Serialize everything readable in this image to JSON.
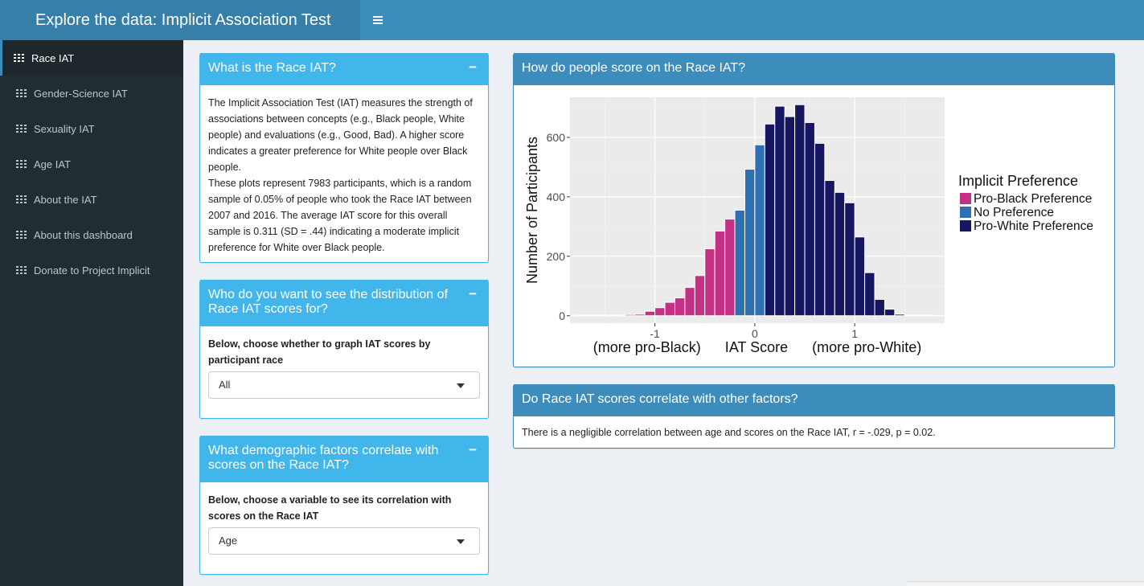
{
  "header": {
    "title": "Explore the data: Implicit Association Test",
    "menu_icon": "hamburger-icon"
  },
  "sidebar": {
    "items": [
      {
        "label": "Race IAT",
        "icon": "grid-icon",
        "active": true
      },
      {
        "label": "Gender-Science IAT",
        "icon": "grid-icon",
        "active": false
      },
      {
        "label": "Sexuality IAT",
        "icon": "grid-icon",
        "active": false
      },
      {
        "label": "Age IAT",
        "icon": "grid-icon",
        "active": false
      },
      {
        "label": "About the IAT",
        "icon": "grid-icon",
        "active": false
      },
      {
        "label": "About this dashboard",
        "icon": "grid-icon",
        "active": false
      },
      {
        "label": "Donate to Project Implicit",
        "icon": "grid-icon",
        "active": false
      }
    ]
  },
  "what_box": {
    "title": "What is the Race IAT?",
    "collapse": "−",
    "para1": "The Implicit Association Test (IAT) measures the strength of associations between concepts (e.g., Black people, White people) and evaluations (e.g., Good, Bad). A higher score indicates a greater preference for White people over Black people.",
    "para2": "These plots represent 7983 participants, which is a random sample of 0.05% of people who took the Race IAT between 2007 and 2016. The average IAT score for this overall sample is 0.311 (SD = .44) indicating a moderate implicit preference for White over Black people."
  },
  "who_box": {
    "title": "Who do you want to see the distribution of Race IAT scores for?",
    "collapse": "−",
    "label": "Below, choose whether to graph IAT scores by participant race",
    "selected": "All"
  },
  "demo_box": {
    "title": "What demographic factors correlate with scores on the Race IAT?",
    "collapse": "−",
    "label": "Below, choose a variable to see its correlation with scores on the Race IAT",
    "selected": "Age"
  },
  "hist_box": {
    "title": "How do people score on the Race IAT?"
  },
  "corr_box": {
    "title": "Do Race IAT scores correlate with other factors?",
    "text": "There is a negligible correlation between age and scores on the Race IAT, r = -.029, p = 0.02."
  },
  "chart_data": {
    "type": "bar",
    "title": "",
    "xlabel": "(more pro-Black)      IAT Score      (more pro-White)",
    "ylabel": "Number of Participants",
    "xlim": [
      -1.85,
      1.9
    ],
    "ylim": [
      -25,
      735
    ],
    "xticks": [
      -1,
      0,
      1
    ],
    "yticks": [
      0,
      200,
      400,
      600
    ],
    "grid": true,
    "legend_position": "right",
    "legend_title": "Implicit Preference",
    "series": [
      {
        "name": "Pro-Black Preference",
        "color": "#c33084"
      },
      {
        "name": "No Preference",
        "color": "#2f70b2"
      },
      {
        "name": "Pro-White Preference",
        "color": "#161760"
      }
    ],
    "bin_width": 0.1,
    "bins": [
      {
        "x": -1.75,
        "y": 2,
        "group": 0
      },
      {
        "x": -1.65,
        "y": 2,
        "group": 0
      },
      {
        "x": -1.55,
        "y": 2,
        "group": 0
      },
      {
        "x": -1.45,
        "y": 2,
        "group": 0
      },
      {
        "x": -1.35,
        "y": 2,
        "group": 0
      },
      {
        "x": -1.25,
        "y": 4,
        "group": 0
      },
      {
        "x": -1.15,
        "y": 5,
        "group": 0
      },
      {
        "x": -1.05,
        "y": 15,
        "group": 0
      },
      {
        "x": -0.95,
        "y": 27,
        "group": 0
      },
      {
        "x": -0.85,
        "y": 45,
        "group": 0
      },
      {
        "x": -0.75,
        "y": 60,
        "group": 0
      },
      {
        "x": -0.65,
        "y": 95,
        "group": 0
      },
      {
        "x": -0.55,
        "y": 135,
        "group": 0
      },
      {
        "x": -0.45,
        "y": 225,
        "group": 0
      },
      {
        "x": -0.35,
        "y": 285,
        "group": 0
      },
      {
        "x": -0.25,
        "y": 325,
        "group": 0
      },
      {
        "x": -0.15,
        "y": 355,
        "group": 1
      },
      {
        "x": -0.05,
        "y": 493,
        "group": 1
      },
      {
        "x": 0.05,
        "y": 575,
        "group": 1
      },
      {
        "x": 0.15,
        "y": 645,
        "group": 2
      },
      {
        "x": 0.25,
        "y": 705,
        "group": 2
      },
      {
        "x": 0.35,
        "y": 670,
        "group": 2
      },
      {
        "x": 0.45,
        "y": 710,
        "group": 2
      },
      {
        "x": 0.55,
        "y": 650,
        "group": 2
      },
      {
        "x": 0.65,
        "y": 580,
        "group": 2
      },
      {
        "x": 0.75,
        "y": 455,
        "group": 2
      },
      {
        "x": 0.85,
        "y": 415,
        "group": 2
      },
      {
        "x": 0.95,
        "y": 380,
        "group": 2
      },
      {
        "x": 1.05,
        "y": 265,
        "group": 2
      },
      {
        "x": 1.15,
        "y": 145,
        "group": 2
      },
      {
        "x": 1.25,
        "y": 55,
        "group": 2
      },
      {
        "x": 1.35,
        "y": 22,
        "group": 2
      },
      {
        "x": 1.45,
        "y": 5,
        "group": 2
      },
      {
        "x": 1.55,
        "y": 2,
        "group": 2
      },
      {
        "x": 1.65,
        "y": 2,
        "group": 2
      },
      {
        "x": 1.75,
        "y": 2,
        "group": 2
      }
    ]
  }
}
